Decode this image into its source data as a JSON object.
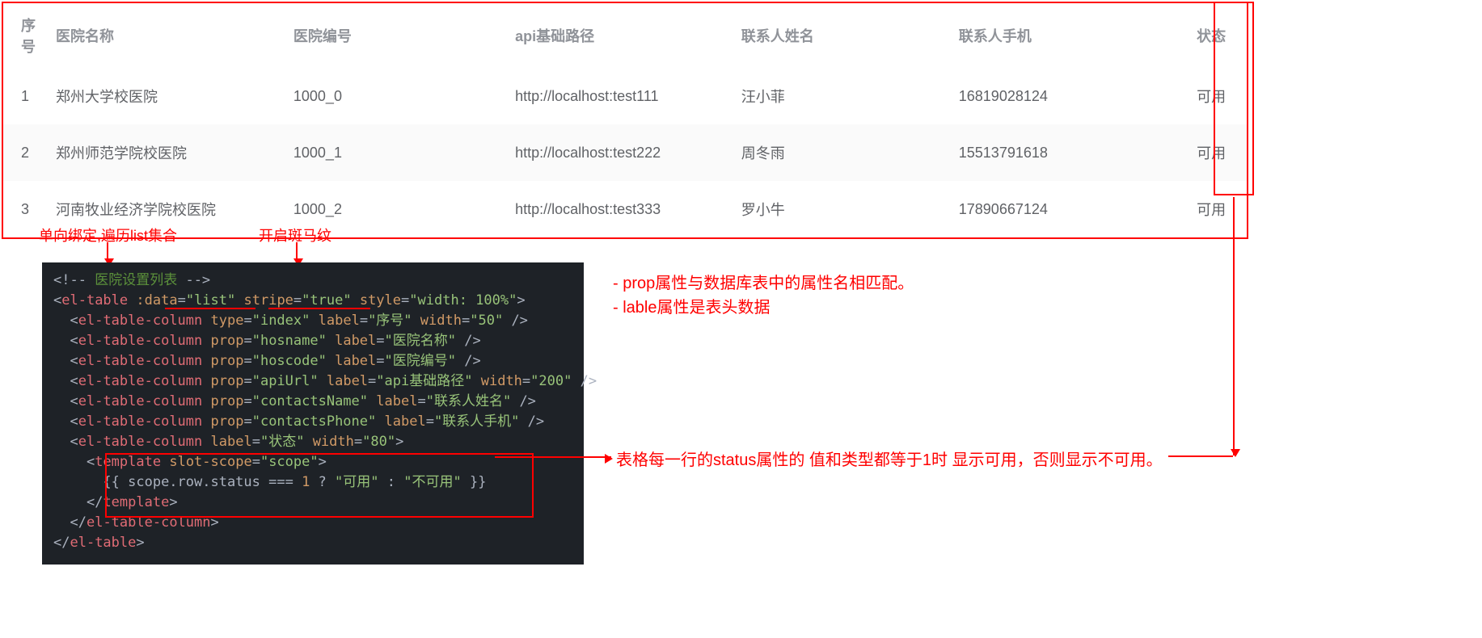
{
  "table": {
    "headers": [
      "序号",
      "医院名称",
      "医院编号",
      "api基础路径",
      "联系人姓名",
      "联系人手机",
      "状态"
    ],
    "rows": [
      {
        "idx": "1",
        "hosname": "郑州大学校医院",
        "hoscode": "1000_0",
        "apiUrl": "http://localhost:test111",
        "contactsName": "汪小菲",
        "contactsPhone": "16819028124",
        "status": "可用"
      },
      {
        "idx": "2",
        "hosname": "郑州师范学院校医院",
        "hoscode": "1000_1",
        "apiUrl": "http://localhost:test222",
        "contactsName": "周冬雨",
        "contactsPhone": "15513791618",
        "status": "可用"
      },
      {
        "idx": "3",
        "hosname": "河南牧业经济学院校医院",
        "hoscode": "1000_2",
        "apiUrl": "http://localhost:test333",
        "contactsName": "罗小牛",
        "contactsPhone": "17890667124",
        "status": "可用"
      }
    ]
  },
  "annotations": {
    "a1": "单向绑定,遍历list集合",
    "a2": "开启斑马纹",
    "note1": "- prop属性与数据库表中的属性名相匹配。",
    "note2": "- lable属性是表头数据",
    "explain": "表格每一行的status属性的 值和类型都等于1时 显示可用，否则显示不可用。"
  },
  "code": {
    "l1": "<!-- 医院设置列表 -->",
    "l2a": "<el-table",
    "l2b": ":data=",
    "l2c": "\"list\"",
    "l2d": "stripe=",
    "l2e": "\"true\"",
    "l2f": "style=",
    "l2g": "\"width: 100%\"",
    "l2h": ">",
    "l3": "  <el-table-column type=\"index\" label=\"序号\" width=\"50\" />",
    "l4": "  <el-table-column prop=\"hosname\" label=\"医院名称\" />",
    "l5": "  <el-table-column prop=\"hoscode\" label=\"医院编号\" />",
    "l6": "  <el-table-column prop=\"apiUrl\" label=\"api基础路径\" width=\"200\" />",
    "l7": "  <el-table-column prop=\"contactsName\" label=\"联系人姓名\" />",
    "l8": "  <el-table-column prop=\"contactsPhone\" label=\"联系人手机\" />",
    "l9": "  <el-table-column label=\"状态\" width=\"80\">",
    "l10": "    <template slot-scope=\"scope\">",
    "l11": "      {{ scope.row.status === 1 ? \"可用\" : \"不可用\" }}",
    "l12": "    </template>",
    "l13": "  </el-table-column>",
    "l14": "</el-table>"
  }
}
